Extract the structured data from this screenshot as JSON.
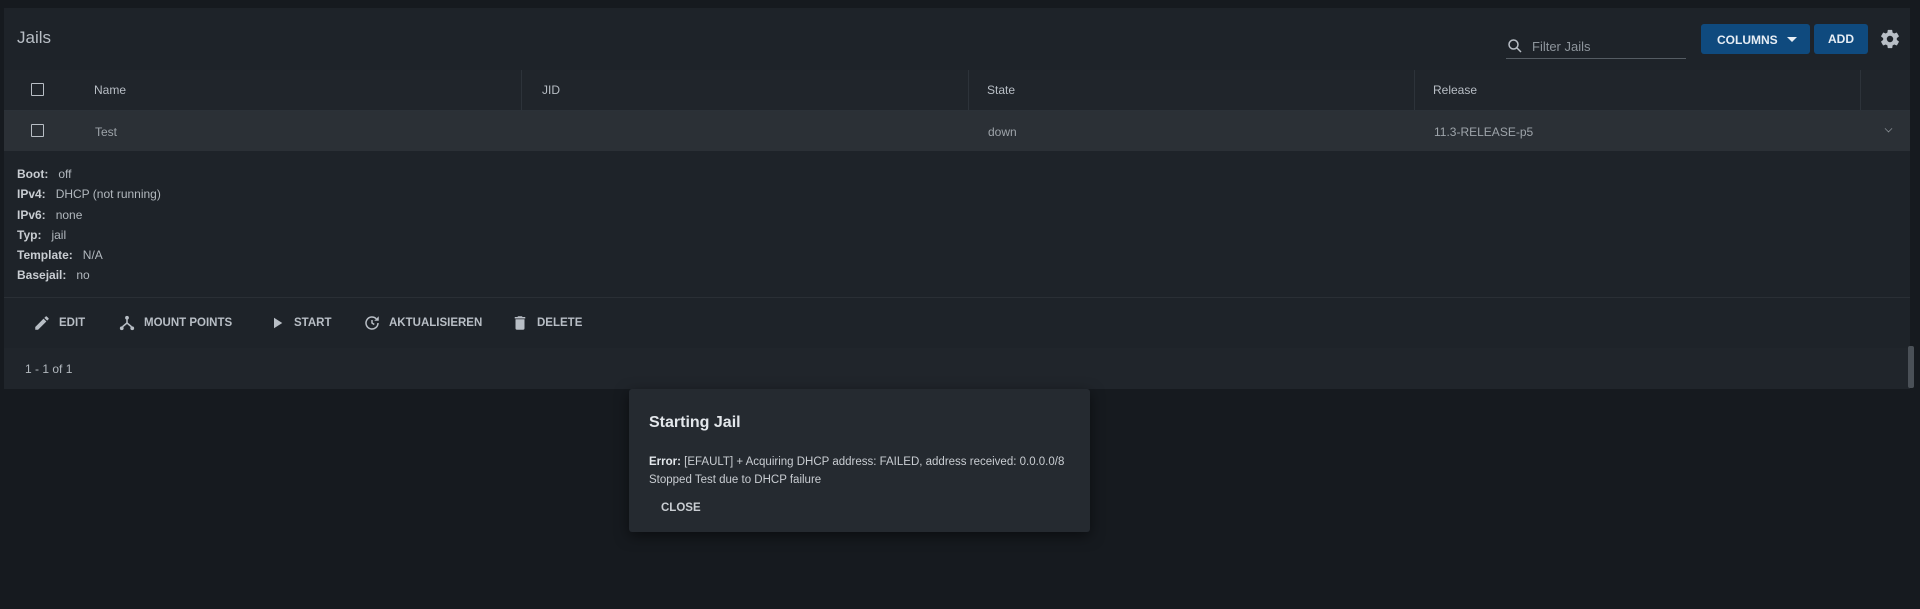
{
  "header": {
    "title": "Jails",
    "search_placeholder": "Filter Jails",
    "columns_label": "COLUMNS",
    "add_label": "ADD"
  },
  "table": {
    "columns": [
      "Name",
      "JID",
      "State",
      "Release"
    ],
    "rows": [
      {
        "name": "Test",
        "jid": "",
        "state": "down",
        "release": "11.3-RELEASE-p5"
      }
    ]
  },
  "details": [
    {
      "key": "Boot:",
      "value": "off"
    },
    {
      "key": "IPv4:",
      "value": "DHCP (not running)"
    },
    {
      "key": "IPv6:",
      "value": "none"
    },
    {
      "key": "Typ:",
      "value": "jail"
    },
    {
      "key": "Template:",
      "value": "N/A"
    },
    {
      "key": "Basejail:",
      "value": "no"
    }
  ],
  "actions": {
    "edit": "EDIT",
    "mount_points": "MOUNT POINTS",
    "start": "START",
    "update": "AKTUALISIEREN",
    "delete": "DELETE"
  },
  "pagination": "1 - 1 of 1",
  "dialog": {
    "title": "Starting Jail",
    "error_label": "Error:",
    "error_text": " [EFAULT] + Acquiring DHCP address: FAILED, address received: 0.0.0.0/8",
    "error_line2": "Stopped Test due to DHCP failure",
    "close_label": "CLOSE"
  },
  "colors": {
    "background": "#161a1f",
    "panel": "#1e2329",
    "accent": "#0f4a7e"
  }
}
